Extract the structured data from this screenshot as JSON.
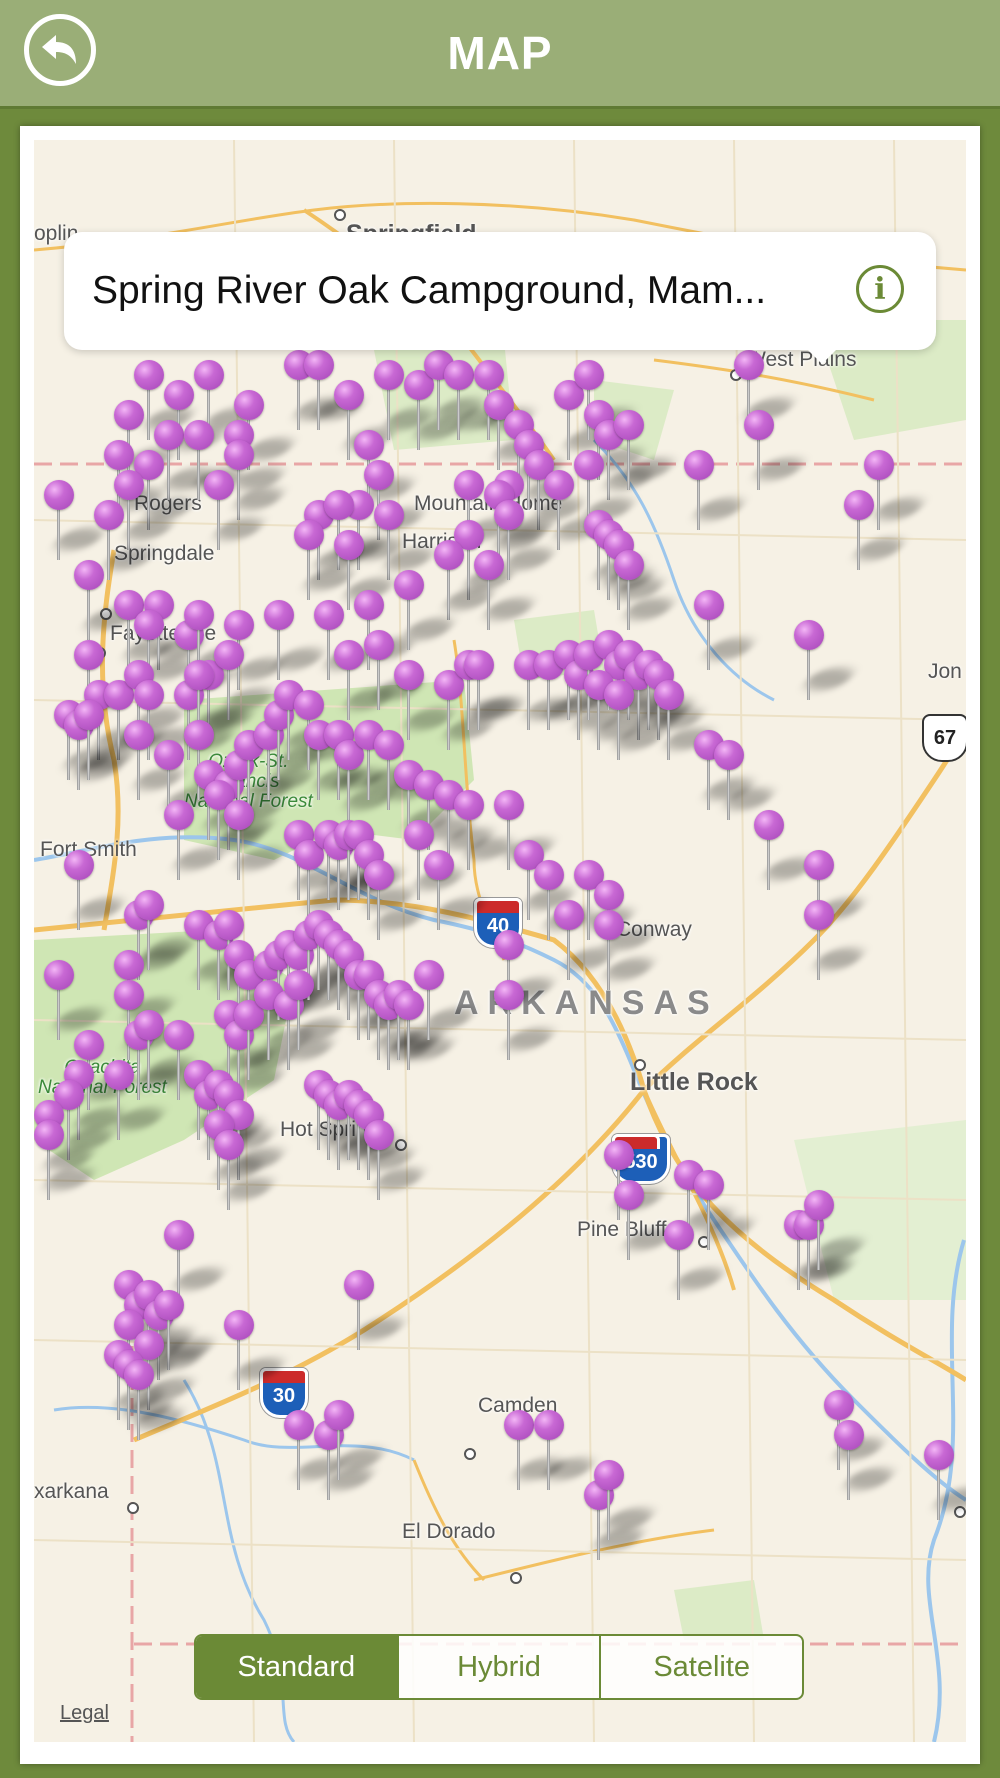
{
  "header": {
    "title": "MAP",
    "back_icon": "back-arrow-icon"
  },
  "callout": {
    "title": "Spring River Oak Campground, Mam...",
    "info_glyph": "i"
  },
  "map": {
    "places": {
      "springfield": "Springfield",
      "west_plains": "West Plains",
      "rogers": "Rogers",
      "springdale": "Springdale",
      "mountain_home": "Mountain Home",
      "harrison": "Harrison",
      "fayetteville": "Fayetteville",
      "jonesboro": "Jon",
      "fort_smith": "Fort Smith",
      "conway": "Conway",
      "state": "ARKANSAS",
      "little_rock": "Little Rock",
      "hot_springs": "Hot Springs",
      "pine_bluff": "Pine Bluff",
      "camden": "Camden",
      "texarkana": "xarkana",
      "el_dorado": "El Dorado",
      "joplin": "oplin"
    },
    "parks": {
      "ozark": "Ozark-St.\nFrancis\nNational Forest",
      "ouachita": "Ouachita\nNational Forest"
    },
    "highways": {
      "i40": "40",
      "i530": "530",
      "i30": "30",
      "us67": "67"
    },
    "pin_color": "#c160d0",
    "legal": "Legal"
  },
  "map_type": {
    "options": [
      "Standard",
      "Hybrid",
      "Satelite"
    ],
    "selected": "Standard"
  }
}
